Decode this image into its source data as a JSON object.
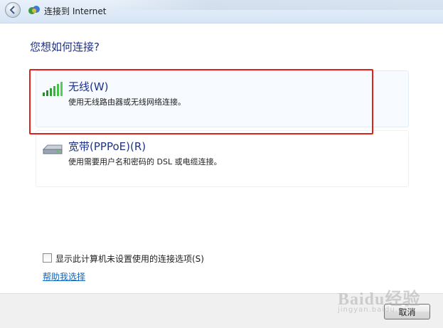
{
  "window": {
    "title": "连接到 Internet"
  },
  "main": {
    "heading": "您想如何连接?",
    "options": [
      {
        "title": "无线(W)",
        "description": "使用无线路由器或无线网络连接。",
        "icon": "wireless-signal-icon"
      },
      {
        "title": "宽带(PPPoE)(R)",
        "description": "使用需要用户名和密码的 DSL 或电缆连接。",
        "icon": "broadband-modem-icon"
      }
    ],
    "show_unavailable_label": "显示此计算机未设置使用的连接选项(S)",
    "show_unavailable_checked": false,
    "help_link": "帮助我选择"
  },
  "footer": {
    "cancel_label": "取消"
  },
  "watermark": {
    "line1": "Baidu经验",
    "line2": "jingyan.baidu.com"
  },
  "colors": {
    "heading": "#1e3287",
    "link": "#0c66c2",
    "highlight": "#e0211c"
  }
}
